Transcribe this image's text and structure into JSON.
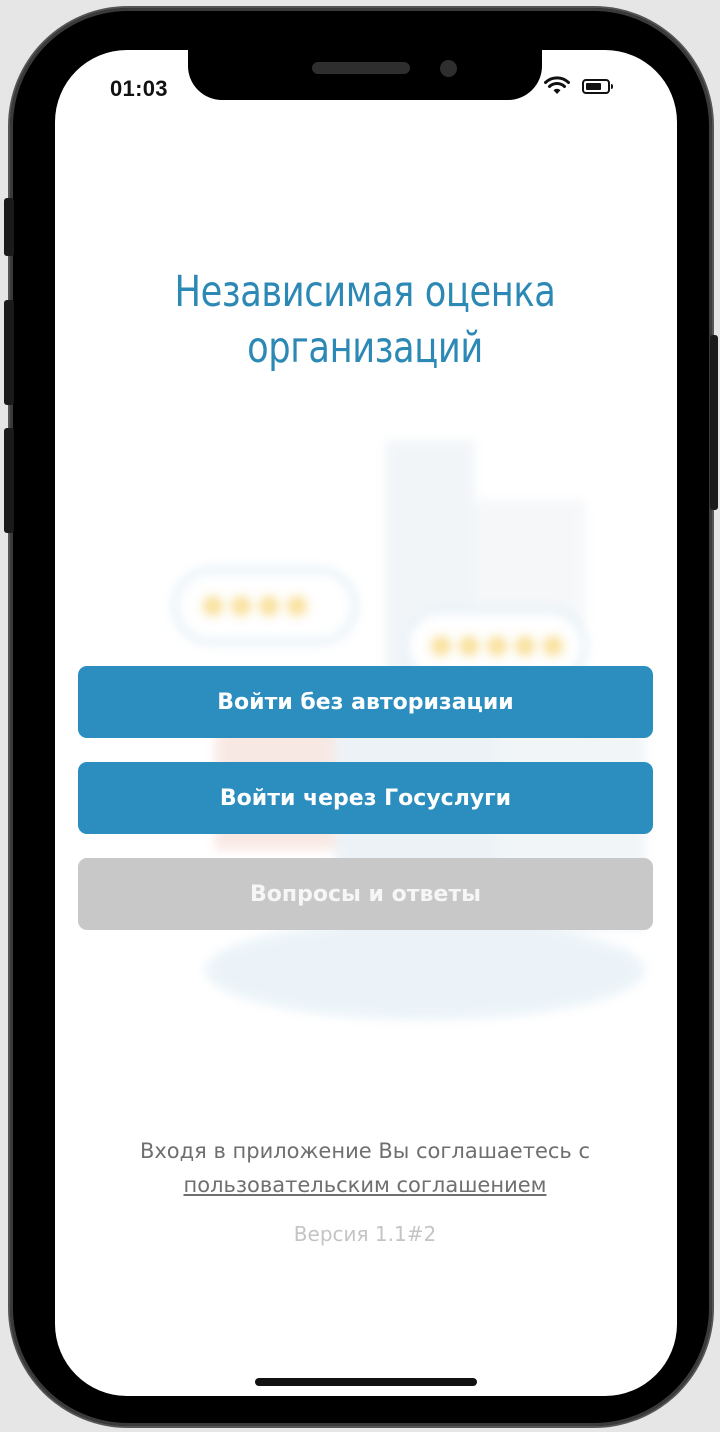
{
  "status_bar": {
    "time": "01:03"
  },
  "app": {
    "title_line1": "Независимая оценка",
    "title_line2": "организаций"
  },
  "buttons": {
    "login_anonymous": "Войти без авторизации",
    "login_gosuslugi": "Войти через Госуслуги",
    "faq": "Вопросы и ответы"
  },
  "footer": {
    "agree_prefix": "Входя в приложение Вы соглашаетесь с",
    "agree_link": "пользовательским соглашением",
    "version": "Версия 1.1#2"
  },
  "colors": {
    "accent": "#2b8ebf",
    "title": "#2c89b5",
    "disabled": "#c8c8c8"
  },
  "icons": [
    "wifi-icon",
    "battery-icon",
    "star-icon"
  ]
}
